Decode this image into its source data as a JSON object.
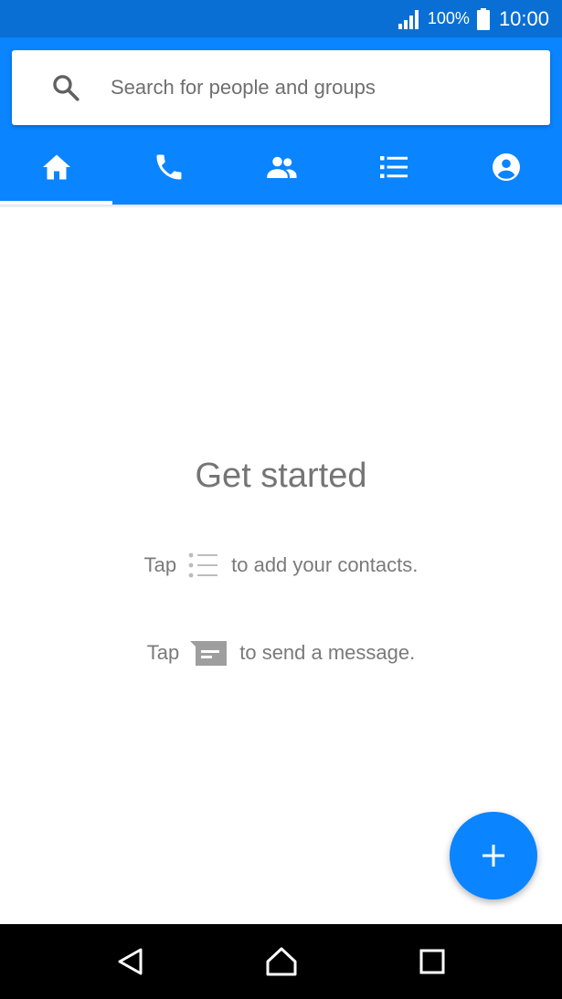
{
  "status_bar": {
    "battery_percent": "100%",
    "time": "10:00",
    "icons": [
      "signal-icon",
      "battery-icon"
    ]
  },
  "search": {
    "placeholder": "Search for people and groups",
    "icon": "search-icon"
  },
  "tabs": [
    {
      "name": "home",
      "icon": "home-icon",
      "active": true
    },
    {
      "name": "calls",
      "icon": "phone-icon",
      "active": false
    },
    {
      "name": "groups",
      "icon": "people-icon",
      "active": false
    },
    {
      "name": "list",
      "icon": "list-icon",
      "active": false
    },
    {
      "name": "profile",
      "icon": "account-icon",
      "active": false
    }
  ],
  "empty_state": {
    "title": "Get started",
    "hint_contacts_prefix": "Tap",
    "hint_contacts_suffix": "to add your contacts.",
    "hint_message_prefix": "Tap",
    "hint_message_suffix": "to send a message."
  },
  "fab": {
    "icon": "plus-icon"
  },
  "nav_bar": {
    "icons": [
      "back-icon",
      "home-nav-icon",
      "recents-icon"
    ]
  },
  "colors": {
    "status_bar": "#0a6fd4",
    "accent": "#0a84ff",
    "nav_bar": "#000000",
    "text_muted": "#757575"
  }
}
